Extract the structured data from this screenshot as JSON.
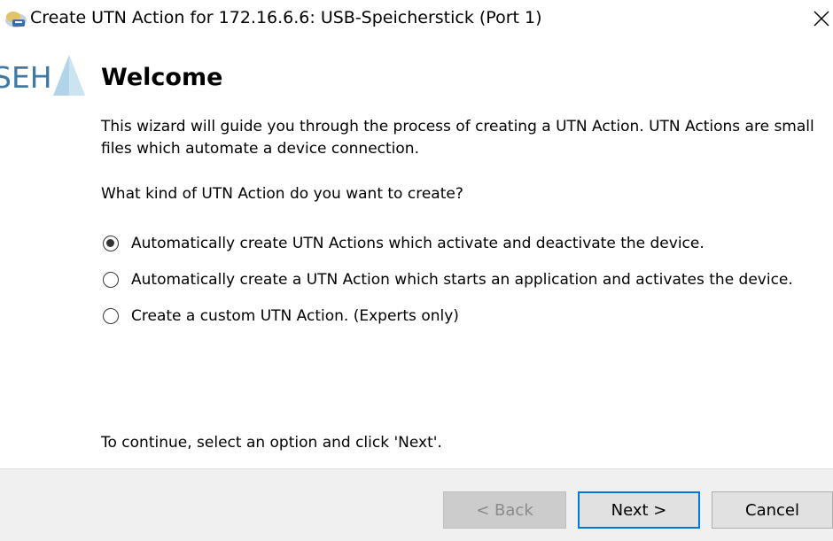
{
  "window": {
    "title": "Create UTN Action for 172.16.6.6: USB-Speicherstick (Port 1)",
    "close_glyph": "✕"
  },
  "logo": {
    "text": "SEH",
    "color": "#3f79a8",
    "accent": "#a9cfe8"
  },
  "page": {
    "heading": "Welcome",
    "intro": "This wizard will guide you through the process of creating a UTN Action. UTN Actions are small files which automate a device connection.",
    "question": "What kind of UTN Action do you want to create?",
    "options": [
      {
        "label": "Automatically create UTN Actions which activate and deactivate the device.",
        "selected": true
      },
      {
        "label": "Automatically create a UTN Action which starts an application and activates the device.",
        "selected": false
      },
      {
        "label": "Create a custom UTN Action. (Experts only)",
        "selected": false
      }
    ],
    "footer_hint": "To continue, select an option and click 'Next'."
  },
  "buttons": {
    "back": {
      "label": "< Back",
      "enabled": false
    },
    "next": {
      "label": "Next >",
      "enabled": true,
      "default": true
    },
    "cancel": {
      "label": "Cancel",
      "enabled": true
    }
  },
  "colors": {
    "focus_border": "#0078d7",
    "button_bar_bg": "#f0f0f0"
  }
}
